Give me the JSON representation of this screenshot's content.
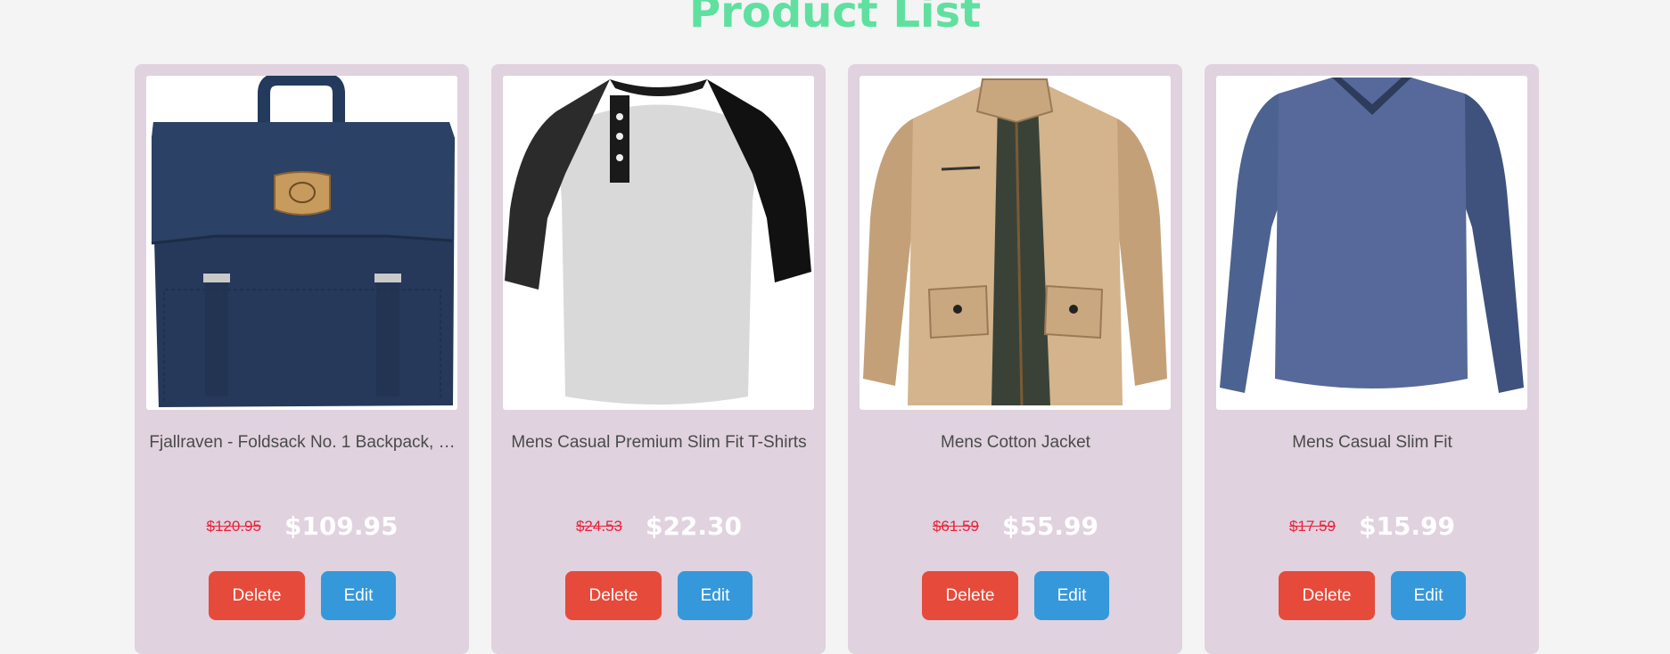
{
  "page": {
    "title": "Product List",
    "title_color": "#5fe0a0",
    "background": "#f4f4f4"
  },
  "products": [
    {
      "name": "Fjallraven - Foldsack No. 1 Backpack, …",
      "old_price": "$120.95",
      "price": "$109.95",
      "image_icon": "backpack-image",
      "delete_label": "Delete",
      "edit_label": "Edit"
    },
    {
      "name": "Mens Casual Premium Slim Fit T-Shirts",
      "old_price": "$24.53",
      "price": "$22.30",
      "image_icon": "raglan-tshirt-image",
      "delete_label": "Delete",
      "edit_label": "Edit"
    },
    {
      "name": "Mens Cotton Jacket",
      "old_price": "$61.59",
      "price": "$55.99",
      "image_icon": "jacket-image",
      "delete_label": "Delete",
      "edit_label": "Edit"
    },
    {
      "name": "Mens Casual Slim Fit",
      "old_price": "$17.59",
      "price": "$15.99",
      "image_icon": "longsleeve-shirt-image",
      "delete_label": "Delete",
      "edit_label": "Edit"
    }
  ],
  "colors": {
    "card_bg": "#e0d2de",
    "old_price": "#e8233a",
    "new_price": "#ffffff",
    "delete_button": "#e64a3b",
    "edit_button": "#3598db"
  }
}
